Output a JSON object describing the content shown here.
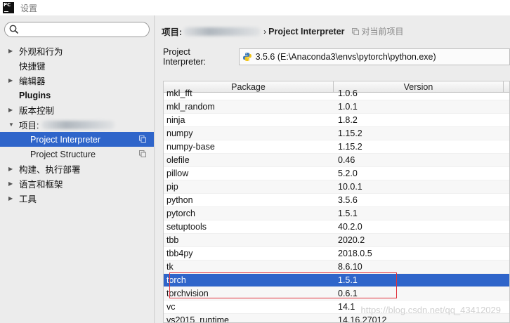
{
  "window": {
    "title": "设置",
    "logo_text": "PC"
  },
  "sidebar": {
    "search": {
      "placeholder": ""
    },
    "items": [
      {
        "label": "外观和行为",
        "arrow": "▶",
        "bold": false
      },
      {
        "label": "快捷键",
        "arrow": "",
        "bold": false
      },
      {
        "label": "编辑器",
        "arrow": "▶",
        "bold": false
      },
      {
        "label": "Plugins",
        "arrow": "",
        "bold": true
      },
      {
        "label": "版本控制",
        "arrow": "▶",
        "bold": false
      },
      {
        "label": "项目:",
        "arrow": "▼",
        "bold": false
      },
      {
        "label": "Project Interpreter",
        "selected": true
      },
      {
        "label": "Project Structure"
      },
      {
        "label": "构建、执行部署",
        "arrow": "▶",
        "bold": false
      },
      {
        "label": "语言和框架",
        "arrow": "▶",
        "bold": false
      },
      {
        "label": "工具",
        "arrow": "▶",
        "bold": false
      }
    ]
  },
  "main": {
    "breadcrumb": {
      "root": "项目:",
      "separator": "›",
      "current": "Project Interpreter",
      "scope": "对当前项目"
    },
    "interpreter": {
      "label": "Project Interpreter:",
      "value": "3.5.6 (E:\\Anaconda3\\envs\\pytorch\\python.exe)"
    },
    "table": {
      "columns": [
        "Package",
        "Version"
      ],
      "rows": [
        {
          "package": "mkl_fft",
          "version": "1.0.6"
        },
        {
          "package": "mkl_random",
          "version": "1.0.1"
        },
        {
          "package": "ninja",
          "version": "1.8.2"
        },
        {
          "package": "numpy",
          "version": "1.15.2"
        },
        {
          "package": "numpy-base",
          "version": "1.15.2"
        },
        {
          "package": "olefile",
          "version": "0.46"
        },
        {
          "package": "pillow",
          "version": "5.2.0"
        },
        {
          "package": "pip",
          "version": "10.0.1"
        },
        {
          "package": "python",
          "version": "3.5.6"
        },
        {
          "package": "pytorch",
          "version": "1.5.1"
        },
        {
          "package": "setuptools",
          "version": "40.2.0"
        },
        {
          "package": "tbb",
          "version": "2020.2"
        },
        {
          "package": "tbb4py",
          "version": "2018.0.5"
        },
        {
          "package": "tk",
          "version": "8.6.10"
        },
        {
          "package": "torch",
          "version": "1.5.1",
          "selected": true
        },
        {
          "package": "torchvision",
          "version": "0.6.1"
        },
        {
          "package": "vc",
          "version": "14.1"
        },
        {
          "package": "vs2015_runtime",
          "version": "14.16.27012"
        }
      ]
    }
  },
  "watermark": "https://blog.csdn.net/qq_43412029",
  "colors": {
    "selection": "#2f65ca",
    "highlight_box": "#e0323c"
  }
}
